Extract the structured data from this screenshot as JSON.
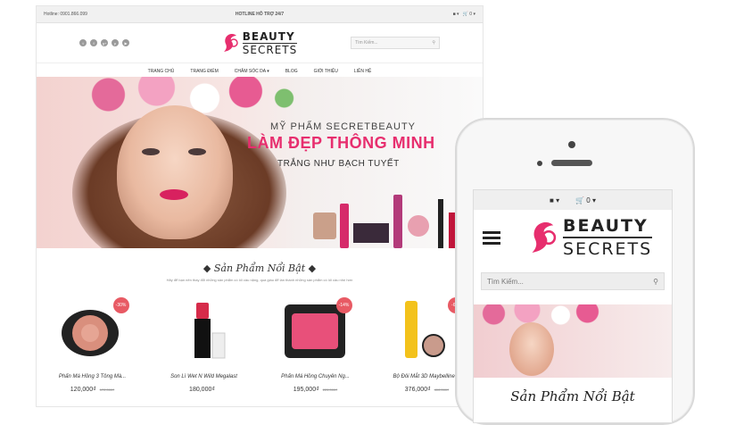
{
  "desktop": {
    "topbar": {
      "hotline": "Hotline: 0901.866.099",
      "support": "HOTLINE HỖ TRỢ 24/7",
      "account": "▾",
      "cart": "0 ▾"
    },
    "header": {
      "social": [
        "t",
        "f",
        "g+",
        "p",
        "▶"
      ],
      "logo": {
        "beauty": "BEAUTY",
        "secrets": "SECRETS"
      },
      "search_placeholder": "Tìm Kiếm..."
    },
    "nav": [
      "TRANG CHỦ",
      "TRANG ĐIỂM",
      "CHĂM SÓC DA ▾",
      "BLOG",
      "GIỚI THIỆU",
      "LIÊN HỆ"
    ],
    "hero": {
      "line1": "MỸ PHẨM SECRETBEAUTY",
      "line2": "LÀM ĐẸP THÔNG MINH",
      "line3": "TRẮNG NHƯ BẠCH TUYẾT"
    },
    "featured": {
      "title": "Sản Phẩm Nổi Bật",
      "subtitle": "Hãy để bạn nên thay đổi những sản phẩm có lối cầu nặng, quá giàu để làn thành những sản phẩm có lối cầu nhẹ hơn"
    },
    "products": [
      {
        "name": "Phấn Má Hồng 3 Tông Mà...",
        "price": "120,000₫",
        "old": "172,000₫",
        "badge": "-30%"
      },
      {
        "name": "Son Lì Wet N Wild Megalast",
        "price": "180,000₫",
        "old": "",
        "badge": ""
      },
      {
        "name": "Phấn Má Hồng Chuyên Ng...",
        "price": "195,000₫",
        "old": "225,000₫",
        "badge": "-14%"
      },
      {
        "name": "Bộ Đôi Mắt 3D Maybelline:...",
        "price": "376,000₫",
        "old": "400,000₫",
        "badge": "-6%"
      }
    ]
  },
  "mobile": {
    "topbar": {
      "account": "▾",
      "cart": "0 ▾"
    },
    "logo": {
      "beauty": "BEAUTY",
      "secrets": "SECRETS"
    },
    "search_placeholder": "Tìm Kiếm...",
    "featured_title": "Sản Phẩm Nổi Bật"
  },
  "colors": {
    "brand_pink": "#e72e6e",
    "badge_red": "#e85a64"
  }
}
